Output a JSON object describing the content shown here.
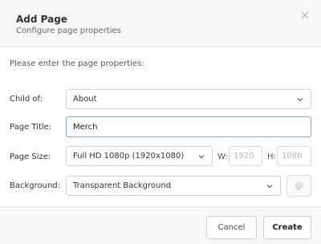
{
  "dialog": {
    "title": "Add Page",
    "subtitle": "Configure page properties",
    "close_icon": "×"
  },
  "form": {
    "intro": "Please enter the page properties:",
    "child_of": {
      "label": "Child of:",
      "value": "About"
    },
    "page_title": {
      "label": "Page Title:",
      "value": "Merch"
    },
    "page_size": {
      "label": "Page Size:",
      "value": "Full HD 1080p (1920x1080)",
      "width_label": "W:",
      "width_placeholder": "1920",
      "height_label": "H:",
      "height_placeholder": "1080"
    },
    "background": {
      "label": "Background:",
      "value": "Transparent Background"
    }
  },
  "footer": {
    "cancel_label": "Cancel",
    "create_label": "Create"
  },
  "colors": {
    "focus_border": "#7fa8cf",
    "header_bg": "#f7f7f7"
  },
  "icons": {
    "dropdown": "chevron-down-icon",
    "close": "close-icon",
    "color_picker": "palette-icon"
  }
}
